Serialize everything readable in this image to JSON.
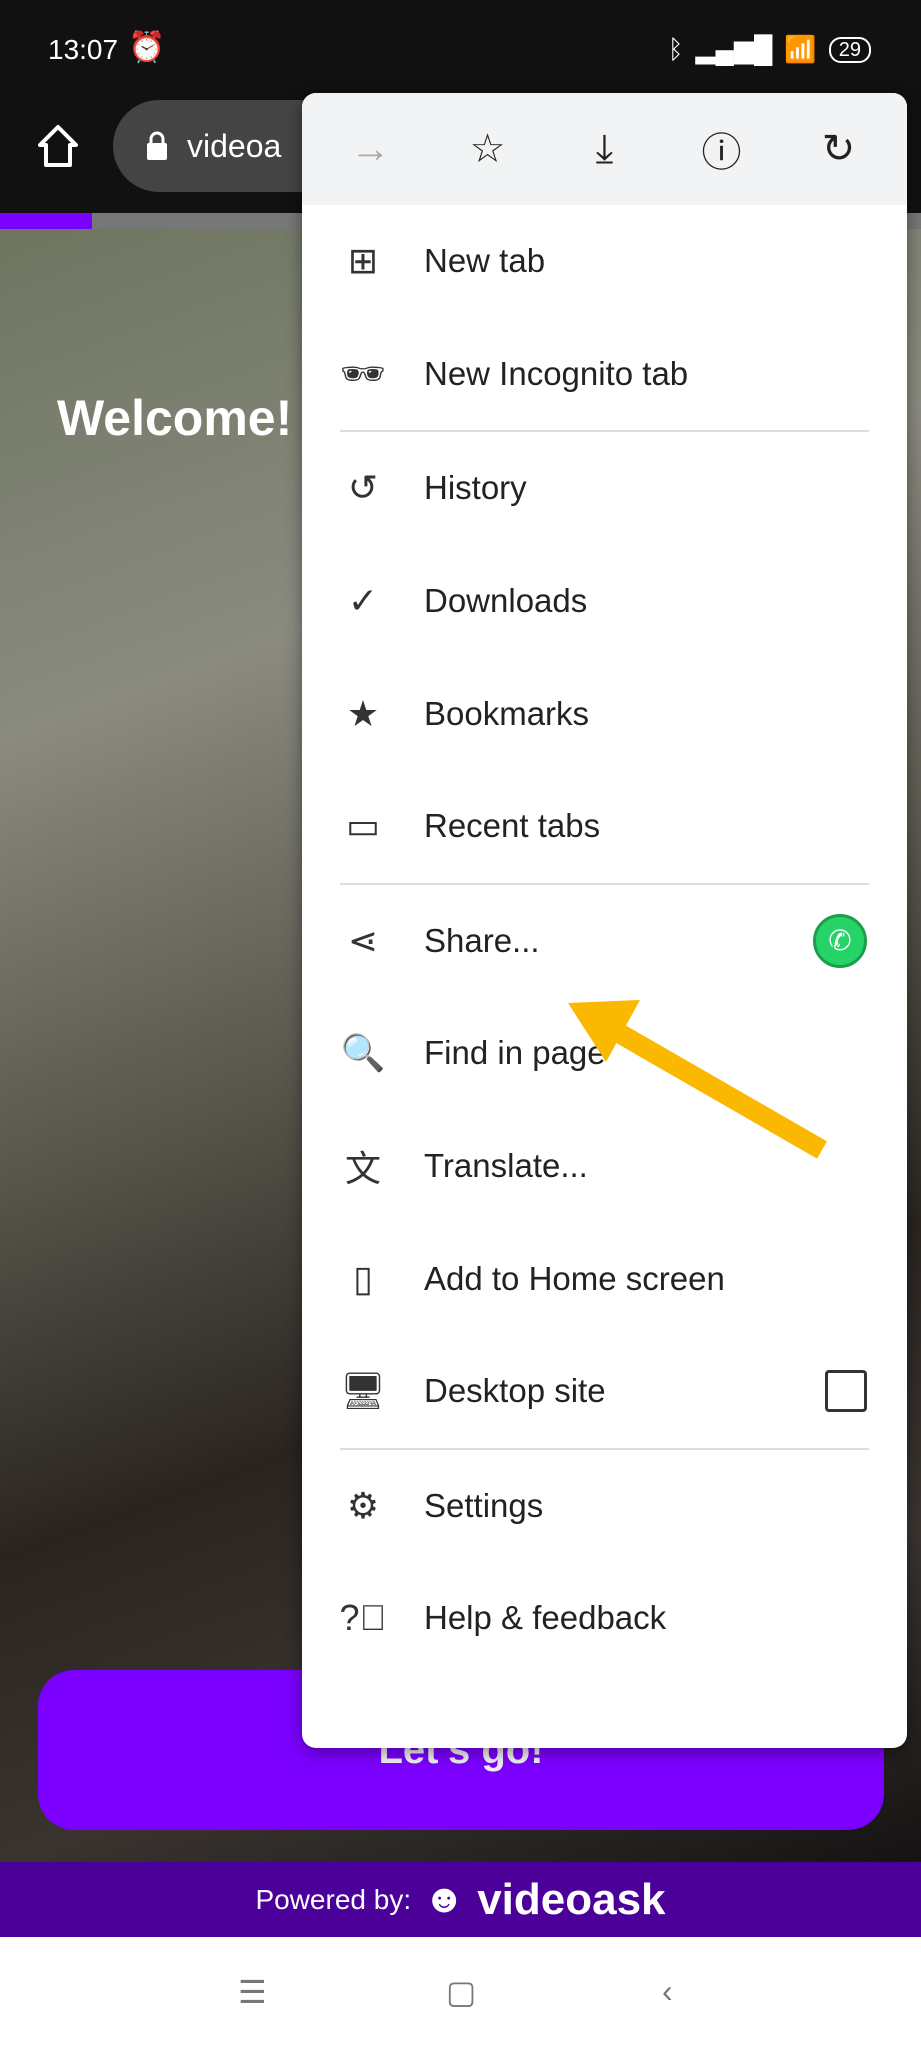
{
  "status": {
    "time": "13:07",
    "battery": "29"
  },
  "toolbar": {
    "url": "videoa"
  },
  "page": {
    "welcome": "Welcome!",
    "cta": "Let's go!",
    "powered_by": "Powered by:",
    "brand": "videoask",
    "progress_percent": 10
  },
  "menu": {
    "top_icons": [
      "forward-icon",
      "bookmark-star-icon",
      "download-icon",
      "info-icon",
      "reload-icon"
    ],
    "items": [
      {
        "label": "New tab",
        "icon": "new-tab-icon"
      },
      {
        "label": "New Incognito tab",
        "icon": "incognito-icon"
      },
      {
        "label": "History",
        "icon": "history-icon"
      },
      {
        "label": "Downloads",
        "icon": "downloads-icon"
      },
      {
        "label": "Bookmarks",
        "icon": "bookmarks-icon"
      },
      {
        "label": "Recent tabs",
        "icon": "recent-tabs-icon"
      },
      {
        "label": "Share...",
        "icon": "share-icon"
      },
      {
        "label": "Find in page",
        "icon": "find-in-page-icon"
      },
      {
        "label": "Translate...",
        "icon": "translate-icon"
      },
      {
        "label": "Add to Home screen",
        "icon": "add-to-home-icon"
      },
      {
        "label": "Desktop site",
        "icon": "desktop-icon",
        "checked": false
      },
      {
        "label": "Settings",
        "icon": "settings-icon"
      },
      {
        "label": "Help & feedback",
        "icon": "help-icon"
      }
    ]
  },
  "colors": {
    "accent": "#7b00ff",
    "annotation_arrow": "#fbb800",
    "whatsapp": "#25d366"
  }
}
